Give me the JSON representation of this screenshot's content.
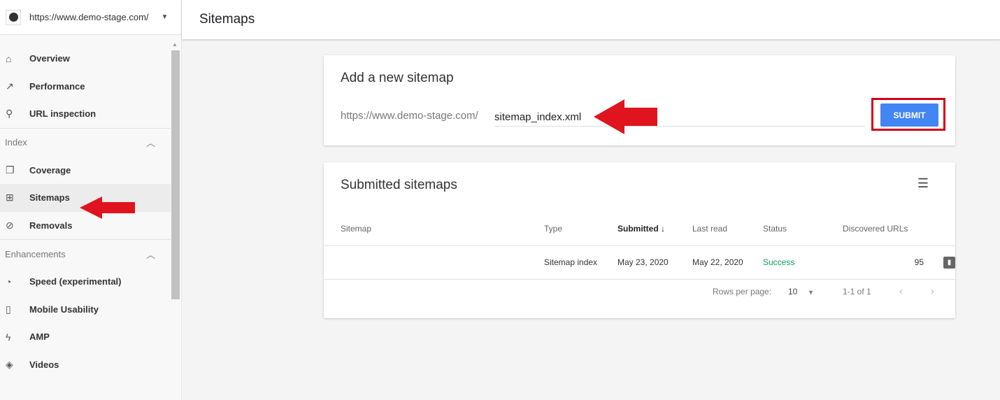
{
  "property": {
    "url": "https://www.demo-stage.com/"
  },
  "nav": {
    "top": [
      {
        "label": "Overview",
        "icon": "home-icon"
      },
      {
        "label": "Performance",
        "icon": "trending-icon"
      },
      {
        "label": "URL inspection",
        "icon": "search-icon"
      }
    ],
    "index": {
      "label": "Index",
      "items": [
        {
          "label": "Coverage",
          "icon": "copy-icon"
        },
        {
          "label": "Sitemaps",
          "icon": "sitemap-icon"
        },
        {
          "label": "Removals",
          "icon": "eye-off-icon"
        }
      ]
    },
    "enhancements": {
      "label": "Enhancements",
      "items": [
        {
          "label": "Speed (experimental)",
          "icon": "speed-icon"
        },
        {
          "label": "Mobile Usability",
          "icon": "phone-icon"
        },
        {
          "label": "AMP",
          "icon": "bolt-icon"
        },
        {
          "label": "Videos",
          "icon": "layers-icon"
        }
      ]
    }
  },
  "header": {
    "title": "Sitemaps"
  },
  "add": {
    "title": "Add a new sitemap",
    "prefix": "https://www.demo-stage.com/",
    "value": "sitemap_index.xml",
    "submit": "SUBMIT"
  },
  "submitted": {
    "title": "Submitted sitemaps",
    "columns": [
      "Sitemap",
      "Type",
      "Submitted",
      "Last read",
      "Status",
      "Discovered URLs"
    ],
    "rows": [
      {
        "sitemap": "",
        "type": "Sitemap index",
        "submitted": "May 23, 2020",
        "last_read": "May 22, 2020",
        "status": "Success",
        "urls": "95"
      }
    ],
    "pager": {
      "rows_label": "Rows per page:",
      "rows_value": "10",
      "range": "1-1 of 1"
    }
  },
  "colors": {
    "accent": "#4285f4",
    "annotation": "#e0141e",
    "success": "#0f9d58"
  }
}
